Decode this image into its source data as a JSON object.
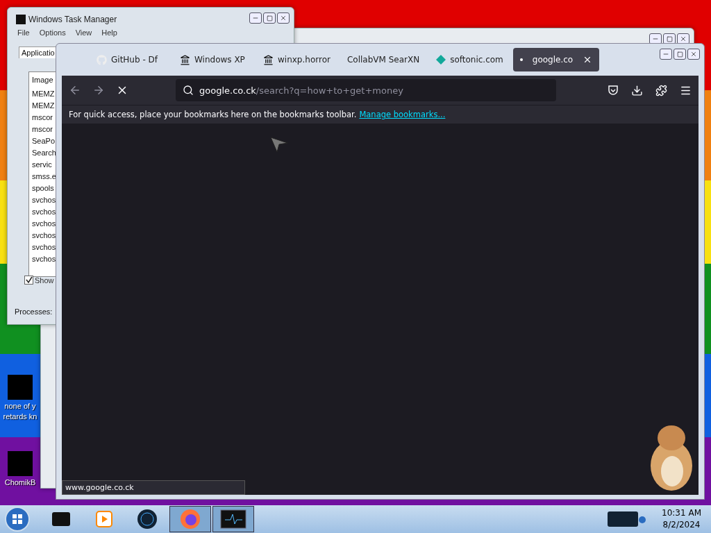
{
  "desktop_icons": [
    {
      "label": "none of y\nretards kn"
    },
    {
      "label": "ChomikB"
    }
  ],
  "task_manager": {
    "title": "Windows Task Manager",
    "menu": [
      "File",
      "Options",
      "View",
      "Help"
    ],
    "tabs": [
      {
        "label": "Applicatio",
        "selected": true
      }
    ],
    "column": "Image",
    "rows": [
      "MEMZ",
      "MEMZ",
      "mscor",
      "mscor",
      "SeaPo",
      "Search",
      "servic",
      "smss.e",
      "spools",
      "svchos",
      "svchos",
      "svchos",
      "svchos",
      "svchos",
      "svchos"
    ],
    "show_all": {
      "label": "Show",
      "checked": true
    },
    "status": "Processes:"
  },
  "browser": {
    "tabs": [
      {
        "kind": "github",
        "label": "GitHub - Df",
        "selected": false
      },
      {
        "kind": "landmark",
        "label": "Windows XP",
        "selected": false
      },
      {
        "kind": "landmark",
        "label": "winxp.horror",
        "selected": false
      },
      {
        "kind": "none",
        "label": "CollabVM SearXN",
        "selected": false
      },
      {
        "kind": "softonic",
        "label": "softonic.com",
        "selected": false
      },
      {
        "kind": "loading",
        "label": "google.co",
        "selected": true
      }
    ],
    "url": {
      "host": "google.co.ck",
      "path": "/search?q=how+to+get+money"
    },
    "bookmarks_hint": "For quick access, place your bookmarks here on the bookmarks toolbar.",
    "bookmarks_link": "Manage bookmarks...",
    "status": "www.google.co.ck"
  },
  "taskbar": {
    "apps": [
      {
        "kind": "printer",
        "selected": false
      },
      {
        "kind": "media",
        "selected": false
      },
      {
        "kind": "globe",
        "selected": false
      },
      {
        "kind": "firefox",
        "selected": true
      },
      {
        "kind": "monitor",
        "selected": true
      }
    ],
    "time": "10:31 AM",
    "date": "8/2/2024"
  }
}
